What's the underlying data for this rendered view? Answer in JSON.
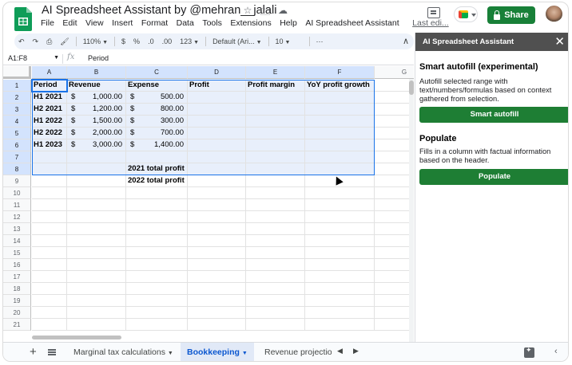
{
  "app": {
    "title": "AI Spreadsheet Assistant by @mehran__jalali",
    "menu": [
      "File",
      "Edit",
      "View",
      "Insert",
      "Format",
      "Data",
      "Tools",
      "Extensions",
      "Help",
      "AI Spreadsheet Assistant"
    ],
    "last_edit": "Last edi...",
    "share_label": "Share",
    "accent_color": "#188038"
  },
  "toolbar": {
    "zoom": "110%",
    "currency": "$",
    "percent": "%",
    "dec_decrease": ".0",
    "dec_increase": ".00",
    "more_formats": "123",
    "font": "Default (Ari...",
    "font_size": "10",
    "more": "⋯",
    "collapse": "∧"
  },
  "formula_bar": {
    "name_box": "A1:F8",
    "fx": "fx",
    "value": "Period"
  },
  "grid": {
    "columns": [
      "A",
      "B",
      "C",
      "D",
      "E",
      "F",
      "G"
    ],
    "rows": [
      "1",
      "2",
      "3",
      "4",
      "5",
      "6",
      "7",
      "8",
      "9",
      "10",
      "11",
      "12",
      "13",
      "14",
      "15",
      "16",
      "17",
      "18",
      "19",
      "20",
      "21"
    ],
    "headers": [
      "Period",
      "Revenue",
      "Expense",
      "Profit",
      "Profit margin",
      "YoY profit growth"
    ],
    "data_rows": [
      {
        "period": "H1 2021",
        "rev_sym": "$",
        "revenue": "1,000.00",
        "exp_sym": "$",
        "expense": "500.00"
      },
      {
        "period": "H2 2021",
        "rev_sym": "$",
        "revenue": "1,200.00",
        "exp_sym": "$",
        "expense": "800.00"
      },
      {
        "period": "H1 2022",
        "rev_sym": "$",
        "revenue": "1,500.00",
        "exp_sym": "$",
        "expense": "300.00"
      },
      {
        "period": "H2 2022",
        "rev_sym": "$",
        "revenue": "2,000.00",
        "exp_sym": "$",
        "expense": "700.00"
      },
      {
        "period": "H1 2023",
        "rev_sym": "$",
        "revenue": "3,000.00",
        "exp_sym": "$",
        "expense": "1,400.00"
      }
    ],
    "totals": [
      "2021 total profit",
      "2022 total profit"
    ]
  },
  "sheet_tabs": {
    "tabs": [
      "Marginal tax calculations",
      "Bookkeeping",
      "Revenue projectio"
    ],
    "active": "Bookkeeping"
  },
  "panel": {
    "title": "AI Spreadsheet Assistant",
    "close": "✕",
    "autofill": {
      "title": "Smart autofill (experimental)",
      "desc": "Autofill selected range with text/numbers/formulas based on context gathered from selection.",
      "button": "Smart autofill"
    },
    "populate": {
      "title": "Populate",
      "desc": "Fills in a column with factual information based on the header.",
      "button": "Populate"
    },
    "button_color": "#1e7e34"
  }
}
